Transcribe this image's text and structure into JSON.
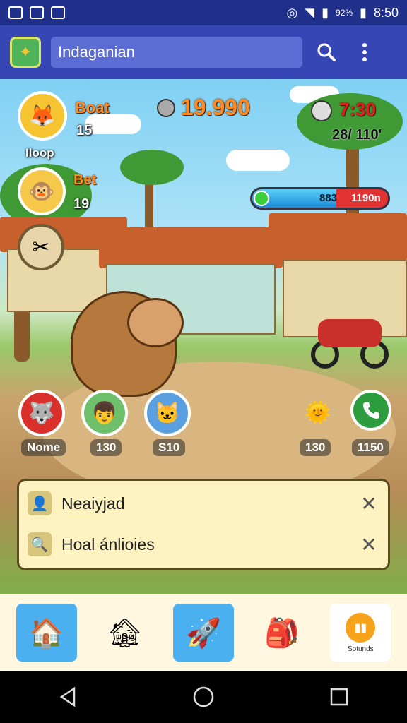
{
  "statusbar": {
    "battery": "92%",
    "time": "8:50"
  },
  "appbar": {
    "search_text": "Indaganian",
    "search_icon": "search-icon",
    "menu_icon": "more-vert-icon"
  },
  "hud": {
    "player1": {
      "name": "Boat",
      "level": "15",
      "tag": "Iloop"
    },
    "player2": {
      "name": "Bet",
      "level": "19"
    },
    "coins": "19.990",
    "timer": "7:30",
    "progress_text": "28/ 110'",
    "bar": {
      "left_value": "883",
      "right_value": "1190n",
      "fill_fraction": 0.62
    }
  },
  "characters": [
    {
      "label": "Nome"
    },
    {
      "label": "130"
    },
    {
      "label": "S10"
    },
    {
      "label": "130"
    },
    {
      "label": "1150"
    }
  ],
  "notifications": [
    {
      "label": "Neaiyjad"
    },
    {
      "label": "Hoal ánlioies"
    }
  ],
  "bottom_nav": {
    "sounds_label": "Sotunds"
  },
  "colors": {
    "appbar": "#3646b5",
    "statusbar": "#1f2f8a",
    "accent": "#4ab0f0",
    "panel": "#fdf2c0"
  }
}
